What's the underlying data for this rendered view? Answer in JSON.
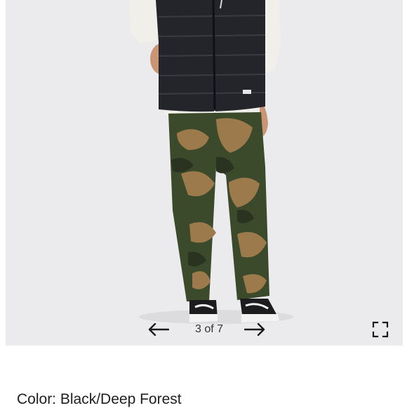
{
  "gallery": {
    "counter": "3 of 7",
    "prev_icon": "arrow-left-icon",
    "next_icon": "arrow-right-icon",
    "fullscreen_icon": "fullscreen-icon"
  },
  "product": {
    "color_label": "Color: ",
    "color_value": "Black/Deep Forest"
  }
}
